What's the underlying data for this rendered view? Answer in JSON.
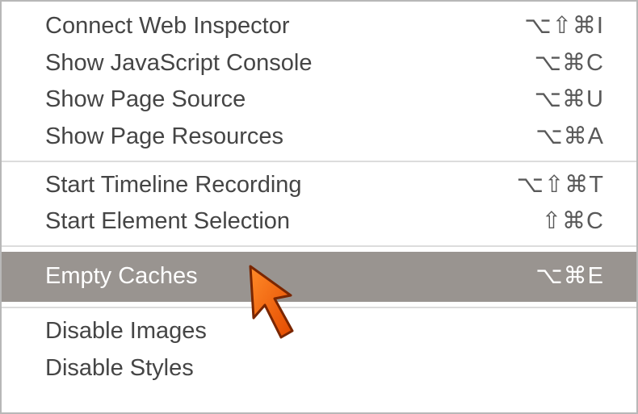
{
  "menu": {
    "groups": [
      {
        "items": [
          {
            "id": "connect-web-inspector",
            "label": "Connect Web Inspector",
            "shortcut": "⌥⇧⌘I"
          },
          {
            "id": "show-javascript-console",
            "label": "Show JavaScript Console",
            "shortcut": "⌥⌘C"
          },
          {
            "id": "show-page-source",
            "label": "Show Page Source",
            "shortcut": "⌥⌘U"
          },
          {
            "id": "show-page-resources",
            "label": "Show Page Resources",
            "shortcut": "⌥⌘A"
          }
        ]
      },
      {
        "items": [
          {
            "id": "start-timeline-recording",
            "label": "Start Timeline Recording",
            "shortcut": "⌥⇧⌘T"
          },
          {
            "id": "start-element-selection",
            "label": "Start Element Selection",
            "shortcut": "⇧⌘C"
          }
        ]
      },
      {
        "items": [
          {
            "id": "empty-caches",
            "label": "Empty Caches",
            "shortcut": "⌥⌘E",
            "highlighted": true
          }
        ]
      },
      {
        "items": [
          {
            "id": "disable-images",
            "label": "Disable Images",
            "shortcut": ""
          },
          {
            "id": "disable-styles",
            "label": "Disable Styles",
            "shortcut": ""
          }
        ]
      }
    ]
  },
  "cursor": {
    "name": "orange-arrow-cursor"
  }
}
